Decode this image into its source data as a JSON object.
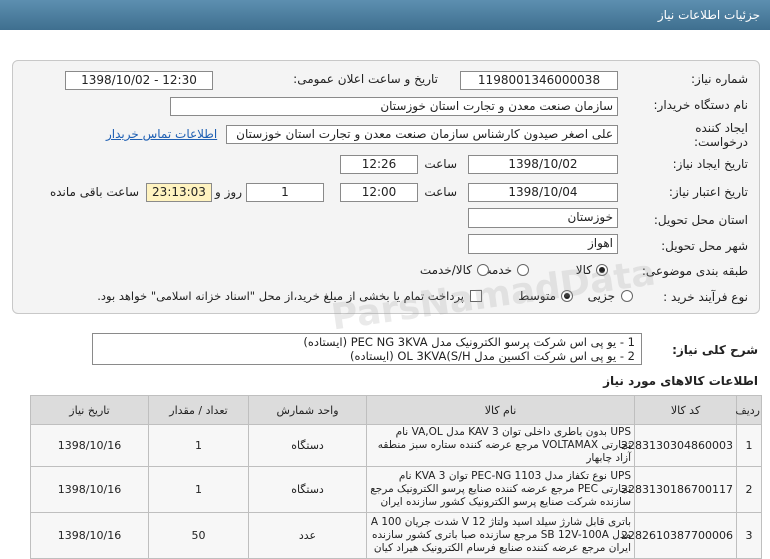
{
  "header": {
    "title": "جزئیات اطلاعات نیاز"
  },
  "form": {
    "need_number_label": "شماره نیاز:",
    "need_number": "1198001346000038",
    "announce_label": "تاریخ و ساعت اعلان عمومی:",
    "announce_value": "1398/10/02 - 12:30",
    "buyer_label": "نام دستگاه خریدار:",
    "buyer_value": "سازمان صنعت معدن و تجارت استان خوزستان",
    "creator_label_1": "ایجاد کننده",
    "creator_label_2": "درخواست:",
    "creator_value": "علی اصغر صیدون کارشناس سازمان صنعت معدن و تجارت استان خوزستان",
    "contact_link": "اطلاعات تماس خریدار",
    "create_date_label": "تاریخ ایجاد نیاز:",
    "create_date": "1398/10/02",
    "time_label": "ساعت",
    "create_time": "12:26",
    "validity_label": "تاریخ اعتبار نیاز:",
    "validity_date": "1398/10/04",
    "validity_time": "12:00",
    "days_value": "1",
    "days_label": "روز و",
    "remaining_value": "23:13:03",
    "remaining_label": "ساعت باقی مانده",
    "province_label": "استان محل تحویل:",
    "province_value": "خوزستان",
    "city_label": "شهر محل تحویل:",
    "city_value": "اهواز",
    "category_label": "طبقه بندی موضوعی:",
    "category_options": [
      "کالا",
      "خدمت",
      "کالا/خدمت"
    ],
    "category_selected": "کالا",
    "process_label": "نوع فرآیند خرید :",
    "process_options": [
      "جزیی",
      "متوسط"
    ],
    "process_selected": "متوسط",
    "payment_text": "پرداخت تمام یا بخشی از مبلغ خرید،از محل \"اسناد خزانه اسلامی\" خواهد بود."
  },
  "description": {
    "label": "شرح کلی نیاز:",
    "line1": "1 - یو پی اس شرکت پرسو الکترونیک مدل PEC NG 3KVA (ایستاده)",
    "line2": "2 - یو پی اس شرکت اکسین مدل OL 3KVA(S/H  (ایستاده)"
  },
  "goods": {
    "title": "اطلاعات کالاهای مورد نیاز",
    "columns": [
      "ردیف",
      "کد کالا",
      "نام کالا",
      "واحد شمارش",
      "تعداد / مقدار",
      "تاریخ نیاز"
    ],
    "rows": [
      {
        "index": "1",
        "code": "2283130304860003",
        "name": "UPS بدون باطری داخلی توان 3 KAV مدل VA,OL نام تجارتی VOLTAMAX مرجع عرضه کننده ستاره سبز منطقه آزاد چابهار",
        "unit": "دستگاه",
        "qty": "1",
        "date": "1398/10/16"
      },
      {
        "index": "2",
        "code": "2283130186700117",
        "name": "UPS نوع تکفاز مدل PEC-NG 1103 توان 3 KVA نام تجارتی PEC مرجع عرضه کننده صنایع پرسو الکترونیک مرجع سازنده شرکت صنایع پرسو الکترونیک کشور سازنده ایران",
        "unit": "دستگاه",
        "qty": "1",
        "date": "1398/10/16"
      },
      {
        "index": "3",
        "code": "2282610387700006",
        "name": "باتری قابل شارژ سیلد اسید ولتاژ 12 V شدت جریان 100 A مدل SB 12V-100A مرجع سازنده صبا باتری کشور سازنده ایران مرجع عرضه کننده صنایع فرسام الکترونیک هیراد کیان",
        "unit": "عدد",
        "qty": "50",
        "date": "1398/10/16"
      }
    ]
  },
  "colors": {
    "header": "#4a7a9b",
    "panel": "#f4f4f4",
    "link": "#1e5fb3",
    "highlight": "#fff3c0"
  }
}
